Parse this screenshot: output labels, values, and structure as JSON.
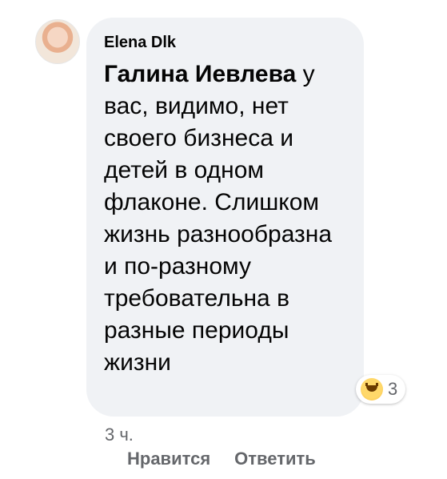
{
  "comment": {
    "author": "Elena Dlk",
    "mention": "Галина Иевлева",
    "text": " у вас, видимо, нет своего бизнеса и детей в одном флаконе. Слишком жизнь разнообразна и по-разному требовательна в разные периоды жизни",
    "time": "3 ч.",
    "reaction_icon": "laughing-emoji-icon",
    "reaction_count": "3"
  },
  "actions": {
    "like": "Нравится",
    "reply": "Ответить"
  },
  "colors": {
    "bubble_bg": "#f0f2f5",
    "text": "#050505",
    "secondary_text": "#65676b"
  }
}
